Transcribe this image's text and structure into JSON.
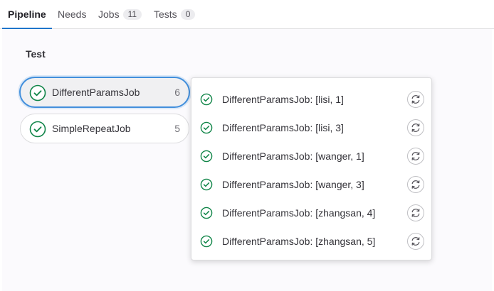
{
  "tabs": [
    {
      "label": "Pipeline",
      "active": true
    },
    {
      "label": "Needs",
      "active": false
    },
    {
      "label": "Jobs",
      "count": "11",
      "active": false
    },
    {
      "label": "Tests",
      "count": "0",
      "active": false
    }
  ],
  "stage": {
    "title": "Test"
  },
  "jobs": [
    {
      "name": "DifferentParamsJob",
      "count": "6",
      "status": "success",
      "selected": true
    },
    {
      "name": "SimpleRepeatJob",
      "count": "5",
      "status": "success",
      "selected": false
    }
  ],
  "dropdown": {
    "items": [
      {
        "label": "DifferentParamsJob: [lisi, 1]",
        "status": "success",
        "action": "retry-icon"
      },
      {
        "label": "DifferentParamsJob: [lisi, 3]",
        "status": "success",
        "action": "retry-icon"
      },
      {
        "label": "DifferentParamsJob: [wanger, 1]",
        "status": "success",
        "action": "retry-icon"
      },
      {
        "label": "DifferentParamsJob: [wanger, 3]",
        "status": "success",
        "action": "retry-icon"
      },
      {
        "label": "DifferentParamsJob: [zhangsan, 4]",
        "status": "success",
        "action": "retry-icon"
      },
      {
        "label": "DifferentParamsJob: [zhangsan, 5]",
        "status": "success",
        "action": "retry-icon"
      }
    ]
  },
  "colors": {
    "success": "#108548",
    "accent": "#1f75cb",
    "focus": "#428fdc"
  }
}
